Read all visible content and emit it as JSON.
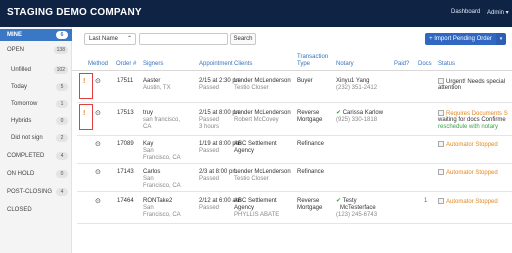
{
  "header": {
    "brand": "STAGING DEMO COMPANY",
    "nav": {
      "dashboard": "Dashboard",
      "admin": "Admin ▾"
    }
  },
  "sidebar": {
    "items": [
      {
        "label": "MINE",
        "count": "6",
        "active": true
      },
      {
        "label": "OPEN",
        "count": "138"
      },
      {
        "label": "Unfilled",
        "count": "102",
        "sub": true
      },
      {
        "label": "Today",
        "count": "5",
        "sub": true
      },
      {
        "label": "Tomorrow",
        "count": "1",
        "sub": true
      },
      {
        "label": "Hybrids",
        "count": "0",
        "sub": true
      },
      {
        "label": "Did not sign",
        "count": "2",
        "sub": true
      },
      {
        "label": "COMPLETED",
        "count": "4"
      },
      {
        "label": "ON HOLD",
        "count": "0"
      },
      {
        "label": "POST-CLOSING",
        "count": "4"
      },
      {
        "label": "CLOSED",
        "count": ""
      }
    ]
  },
  "toolbar": {
    "page_size": "Last Name",
    "search_placeholder": "",
    "search_button": "Search",
    "import_button": "+ Import Pending Order",
    "import_caret": "▾"
  },
  "table": {
    "headers": {
      "method": "Method",
      "order": "Order #",
      "signers": "Signers",
      "appointment": "Appointment",
      "clients": "Clients",
      "transaction_1": "Transaction",
      "transaction_2": "Type",
      "notary": "Notary",
      "paid": "Paid?",
      "docs": "Docs",
      "status": "Status"
    },
    "rows": [
      {
        "method": "!",
        "order": "17511",
        "signer_name": "Aaster",
        "signer_loc": "Austin, TX",
        "appt_1": "2/15 at 2:30 pm",
        "appt_2": "Passed",
        "appt_3": "",
        "client_1": "Lender McLenderson",
        "client_2": "Testio Closer",
        "client_3": "",
        "type_1": "Buyer",
        "type_2": "",
        "notary_check": "",
        "notary_name": "Xinyu1 Yang",
        "notary_phone": "(232) 351-2412",
        "docs": "",
        "status_1": "Urgent! Needs special",
        "status_2": "attention",
        "status_3": ""
      },
      {
        "method": "!",
        "order": "17513",
        "signer_name": "truy",
        "signer_loc": "san francisco,",
        "signer_loc_2": "CA",
        "appt_1": "2/15 at 8:00 pm",
        "appt_2": "Passed",
        "appt_3": "3 hours",
        "client_1": "Lender McLenderson",
        "client_2": "Robert McCovey",
        "client_3": "",
        "type_1": "Reverse",
        "type_2": "Mortgage",
        "notary_check": "✔",
        "notary_name": "Carissa Karlow",
        "notary_phone": "(925) 330-1818",
        "docs": "",
        "status_1": "Requires Documents S",
        "status_2": "waiting for docs Confirme",
        "status_3": "reschedule with notary"
      },
      {
        "method": "",
        "order": "17089",
        "signer_name": "Kay",
        "signer_loc": "San",
        "signer_loc_2": "Francisco, CA",
        "appt_1": "1/19 at 8:00 pm",
        "appt_2": "Passed",
        "appt_3": "",
        "client_1": "ABC Settlement",
        "client_2": "Agency",
        "client_3": "",
        "type_1": "Refinance",
        "type_2": "",
        "notary_check": "",
        "notary_name": "",
        "notary_phone": "",
        "docs": "",
        "status_1": "Automator Stopped",
        "status_2": "",
        "status_3": ""
      },
      {
        "method": "",
        "order": "17143",
        "signer_name": "Carlos",
        "signer_loc": "San",
        "signer_loc_2": "Francisco, CA",
        "appt_1": "2/3 at 8:00 pm",
        "appt_2": "Passed",
        "appt_3": "",
        "client_1": "Lender McLenderson",
        "client_2": "Testio Closer",
        "client_3": "",
        "type_1": "Refinance",
        "type_2": "",
        "notary_check": "",
        "notary_name": "",
        "notary_phone": "",
        "docs": "",
        "status_1": "Automator Stopped",
        "status_2": "",
        "status_3": ""
      },
      {
        "method": "",
        "order": "17464",
        "signer_name": "RONTake2",
        "signer_loc": "San",
        "signer_loc_2": "Francisco, CA",
        "appt_1": "2/12 at 6:00 am",
        "appt_2": "Passed",
        "appt_3": "",
        "client_1": "ABC Settlement",
        "client_2": "Agency",
        "client_3": "PHYLLIS ABATE",
        "type_1": "Reverse",
        "type_2": "Mortgage",
        "notary_check": "✔",
        "notary_name": "Testy",
        "notary_name_2": "McTesterface",
        "notary_phone": "(123) 245-6743",
        "docs": "1",
        "status_1": "Automator Stopped",
        "status_2": "",
        "status_3": ""
      }
    ]
  },
  "colors": {
    "topbar": "#0f2345",
    "accent": "#3a77c4",
    "method_flag": "#e08a22",
    "ok_green": "#3aa34a",
    "highlight_box": "#e04040"
  }
}
